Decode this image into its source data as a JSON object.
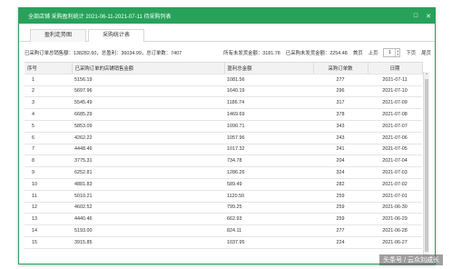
{
  "window": {
    "title": "全部店铺  采购盈利统计  2021-06-11-2021-07-11  待采购列表",
    "maximize_glyph": "□",
    "close_glyph": "✕"
  },
  "tabs": [
    {
      "label": "盈利走势图",
      "active": false
    },
    {
      "label": "采购统计表",
      "active": true
    }
  ],
  "summary": {
    "left": "已采购订单总销售额：138282.60，总盈利：36034.99，总订单数：7407",
    "pending_amount": "所有未发货金额：3181.78",
    "pending_purchase": "已采购未发货金额：2254.48",
    "first": "首页",
    "prev": "上页",
    "page": "1",
    "next": "下页",
    "last": "尾页"
  },
  "table": {
    "headers": [
      "序号",
      "已采购订单的店铺销售金额",
      "盈利总金额",
      "采购订单数",
      "日期"
    ],
    "rows": [
      [
        "1",
        "5156.19",
        "1081.56",
        "277",
        "2021-07-11"
      ],
      [
        "2",
        "5697.96",
        "1640.19",
        "296",
        "2021-07-10"
      ],
      [
        "3",
        "5545.49",
        "1186.74",
        "317",
        "2021-07-09"
      ],
      [
        "4",
        "6685.29",
        "1469.69",
        "378",
        "2021-07-08"
      ],
      [
        "5",
        "5853.09",
        "1090.71",
        "343",
        "2021-07-07"
      ],
      [
        "6",
        "4262.22",
        "1057.96",
        "243",
        "2021-07-06"
      ],
      [
        "7",
        "4448.46",
        "1017.32",
        "241",
        "2021-07-05"
      ],
      [
        "8",
        "3775.31",
        "734.78",
        "204",
        "2021-07-04"
      ],
      [
        "9",
        "6252.81",
        "1286.26",
        "324",
        "2021-07-03"
      ],
      [
        "10",
        "4881.83",
        "589.49",
        "282",
        "2021-07-02"
      ],
      [
        "11",
        "5010.21",
        "1120.50",
        "259",
        "2021-07-01"
      ],
      [
        "12",
        "4602.52",
        "799.25",
        "259",
        "2021-06-30"
      ],
      [
        "13",
        "4440.46",
        "662.93",
        "259",
        "2021-06-29"
      ],
      [
        "14",
        "5193.00",
        "824.11",
        "277",
        "2021-06-28"
      ],
      [
        "15",
        "3915.85",
        "1037.95",
        "224",
        "2021-06-27"
      ]
    ]
  },
  "watermark": "头条号 / 云众刘成长"
}
